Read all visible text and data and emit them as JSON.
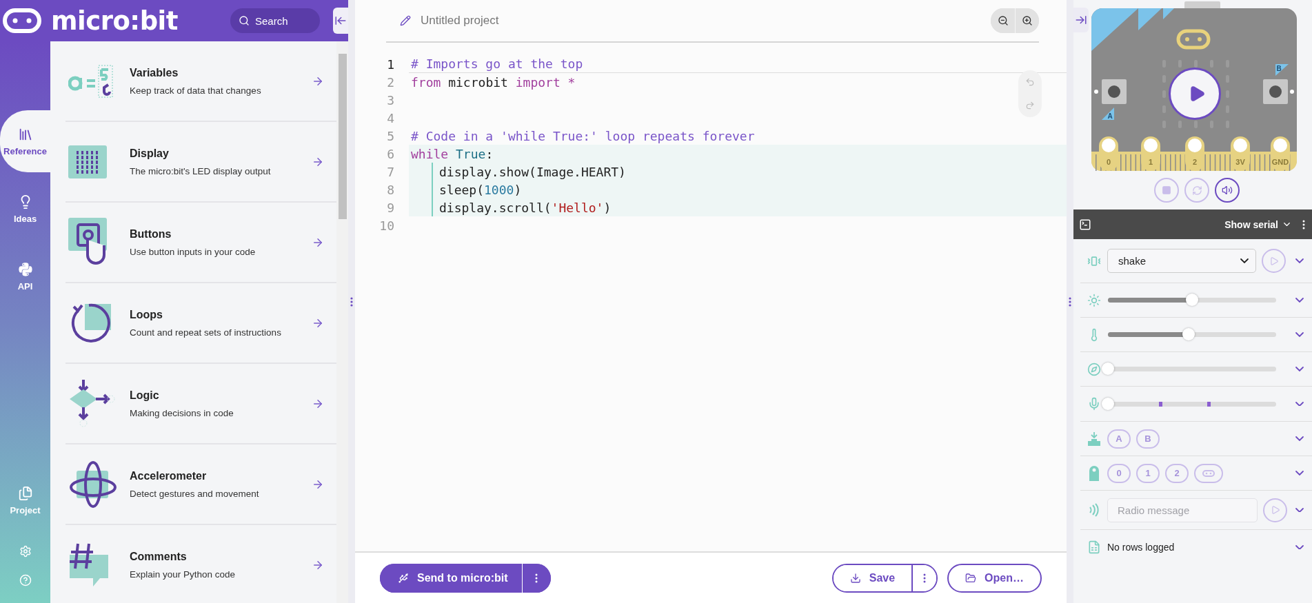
{
  "brand": {
    "name": "micro:bit"
  },
  "search": {
    "placeholder": "Search"
  },
  "nav": [
    {
      "label": "Reference",
      "selected": true
    },
    {
      "label": "Ideas",
      "selected": false
    },
    {
      "label": "API",
      "selected": false
    },
    {
      "label": "Project",
      "selected": false
    }
  ],
  "reference_items": [
    {
      "title": "Variables",
      "description": "Keep track of data that changes"
    },
    {
      "title": "Display",
      "description": "The micro:bit's LED display output"
    },
    {
      "title": "Buttons",
      "description": "Use button inputs in your code"
    },
    {
      "title": "Loops",
      "description": "Count and repeat sets of instructions"
    },
    {
      "title": "Logic",
      "description": "Making decisions in code"
    },
    {
      "title": "Accelerometer",
      "description": "Detect gestures and movement"
    },
    {
      "title": "Comments",
      "description": "Explain your Python code"
    }
  ],
  "project": {
    "title": "Untitled project"
  },
  "code_lines": [
    {
      "number": "1",
      "active": true,
      "highlighted": false,
      "tokens": [
        {
          "kind": "comment",
          "text": "# Imports go at the top"
        }
      ]
    },
    {
      "number": "2",
      "active": false,
      "highlighted": false,
      "tokens": [
        {
          "kind": "keyword",
          "text": "from"
        },
        {
          "kind": "plain",
          "text": " microbit "
        },
        {
          "kind": "keyword",
          "text": "import"
        },
        {
          "kind": "operator",
          "text": " *"
        }
      ]
    },
    {
      "number": "3",
      "active": false,
      "highlighted": false
    },
    {
      "number": "4",
      "active": false,
      "highlighted": false
    },
    {
      "number": "5",
      "active": false,
      "highlighted": false,
      "tokens": [
        {
          "kind": "comment",
          "text": "# Code in a 'while True:' loop repeats forever"
        }
      ]
    },
    {
      "number": "6",
      "active": false,
      "highlighted": true,
      "tokens": [
        {
          "kind": "keyword",
          "text": "while"
        },
        {
          "kind": "builtin",
          "text": " True"
        },
        {
          "kind": "plain",
          "text": ":"
        }
      ],
      "children": [
        {
          "number": "7",
          "active": false,
          "tokens": [
            {
              "kind": "plain",
              "text": "display.show(Image.HEART)"
            }
          ]
        },
        {
          "number": "8",
          "active": false,
          "tokens": [
            {
              "kind": "plain",
              "text": "sleep("
            },
            {
              "kind": "number",
              "text": "1000"
            },
            {
              "kind": "plain",
              "text": ")"
            }
          ]
        },
        {
          "number": "9",
          "active": false,
          "tokens": [
            {
              "kind": "plain",
              "text": "display.scroll("
            },
            {
              "kind": "string",
              "text": "'Hello'"
            },
            {
              "kind": "plain",
              "text": ")"
            }
          ]
        }
      ]
    },
    {
      "number": "10",
      "active": false,
      "highlighted": false
    }
  ],
  "actions": {
    "send": "Send to micro:bit",
    "save": "Save",
    "open": "Open…"
  },
  "simulator": {
    "pins": [
      "0",
      "1",
      "2",
      "3V",
      "GND"
    ],
    "buttons": [
      "A",
      "B"
    ],
    "controls": [
      {
        "kind": "stop",
        "disabled": true
      },
      {
        "kind": "reset",
        "disabled": true
      },
      {
        "kind": "sound",
        "disabled": false
      }
    ]
  },
  "serial": {
    "label": "Show serial"
  },
  "sensors": [
    {
      "kind": "gesture",
      "value": "shake",
      "disabled": true
    },
    {
      "kind": "light",
      "level": 0.5
    },
    {
      "kind": "temperature",
      "level": 0.48
    },
    {
      "kind": "compass",
      "level": 0
    },
    {
      "kind": "sound",
      "level": 0
    },
    {
      "kind": "buttons",
      "labels": [
        "A",
        "B"
      ],
      "disabled": true
    },
    {
      "kind": "pins",
      "labels": [
        "0",
        "1",
        "2"
      ],
      "disabled": true
    },
    {
      "kind": "radio",
      "placeholder": "Radio message",
      "disabled": true
    },
    {
      "kind": "datalog",
      "text": "No rows logged"
    }
  ]
}
